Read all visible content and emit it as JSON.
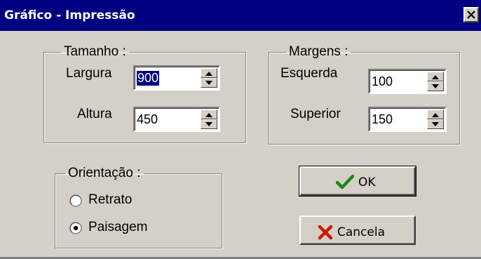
{
  "window": {
    "title": "Gráfico - Impressão",
    "close_label": "×"
  },
  "tamanho": {
    "legend": "Tamanho :",
    "largura_label": "Largura",
    "largura_value": "900",
    "altura_label": "Altura",
    "altura_value": "450"
  },
  "margens": {
    "legend": "Margens :",
    "esquerda_label": "Esquerda",
    "esquerda_value": "100",
    "superior_label": "Superior",
    "superior_value": "150"
  },
  "orientacao": {
    "legend": "Orientação :",
    "options": [
      {
        "label": "Retrato",
        "selected": false
      },
      {
        "label": "Paisagem",
        "selected": true
      }
    ]
  },
  "buttons": {
    "ok_label": "OK",
    "cancel_label": "Cancela"
  },
  "icons": {
    "ok": "check-icon",
    "cancel": "x-icon",
    "close": "close-icon",
    "spin_up": "arrow-up-icon",
    "spin_down": "arrow-down-icon"
  },
  "colors": {
    "titlebar": "#000080",
    "face": "#d4d0c8",
    "check": "#1a8a1a",
    "cross": "#cc1a00"
  }
}
